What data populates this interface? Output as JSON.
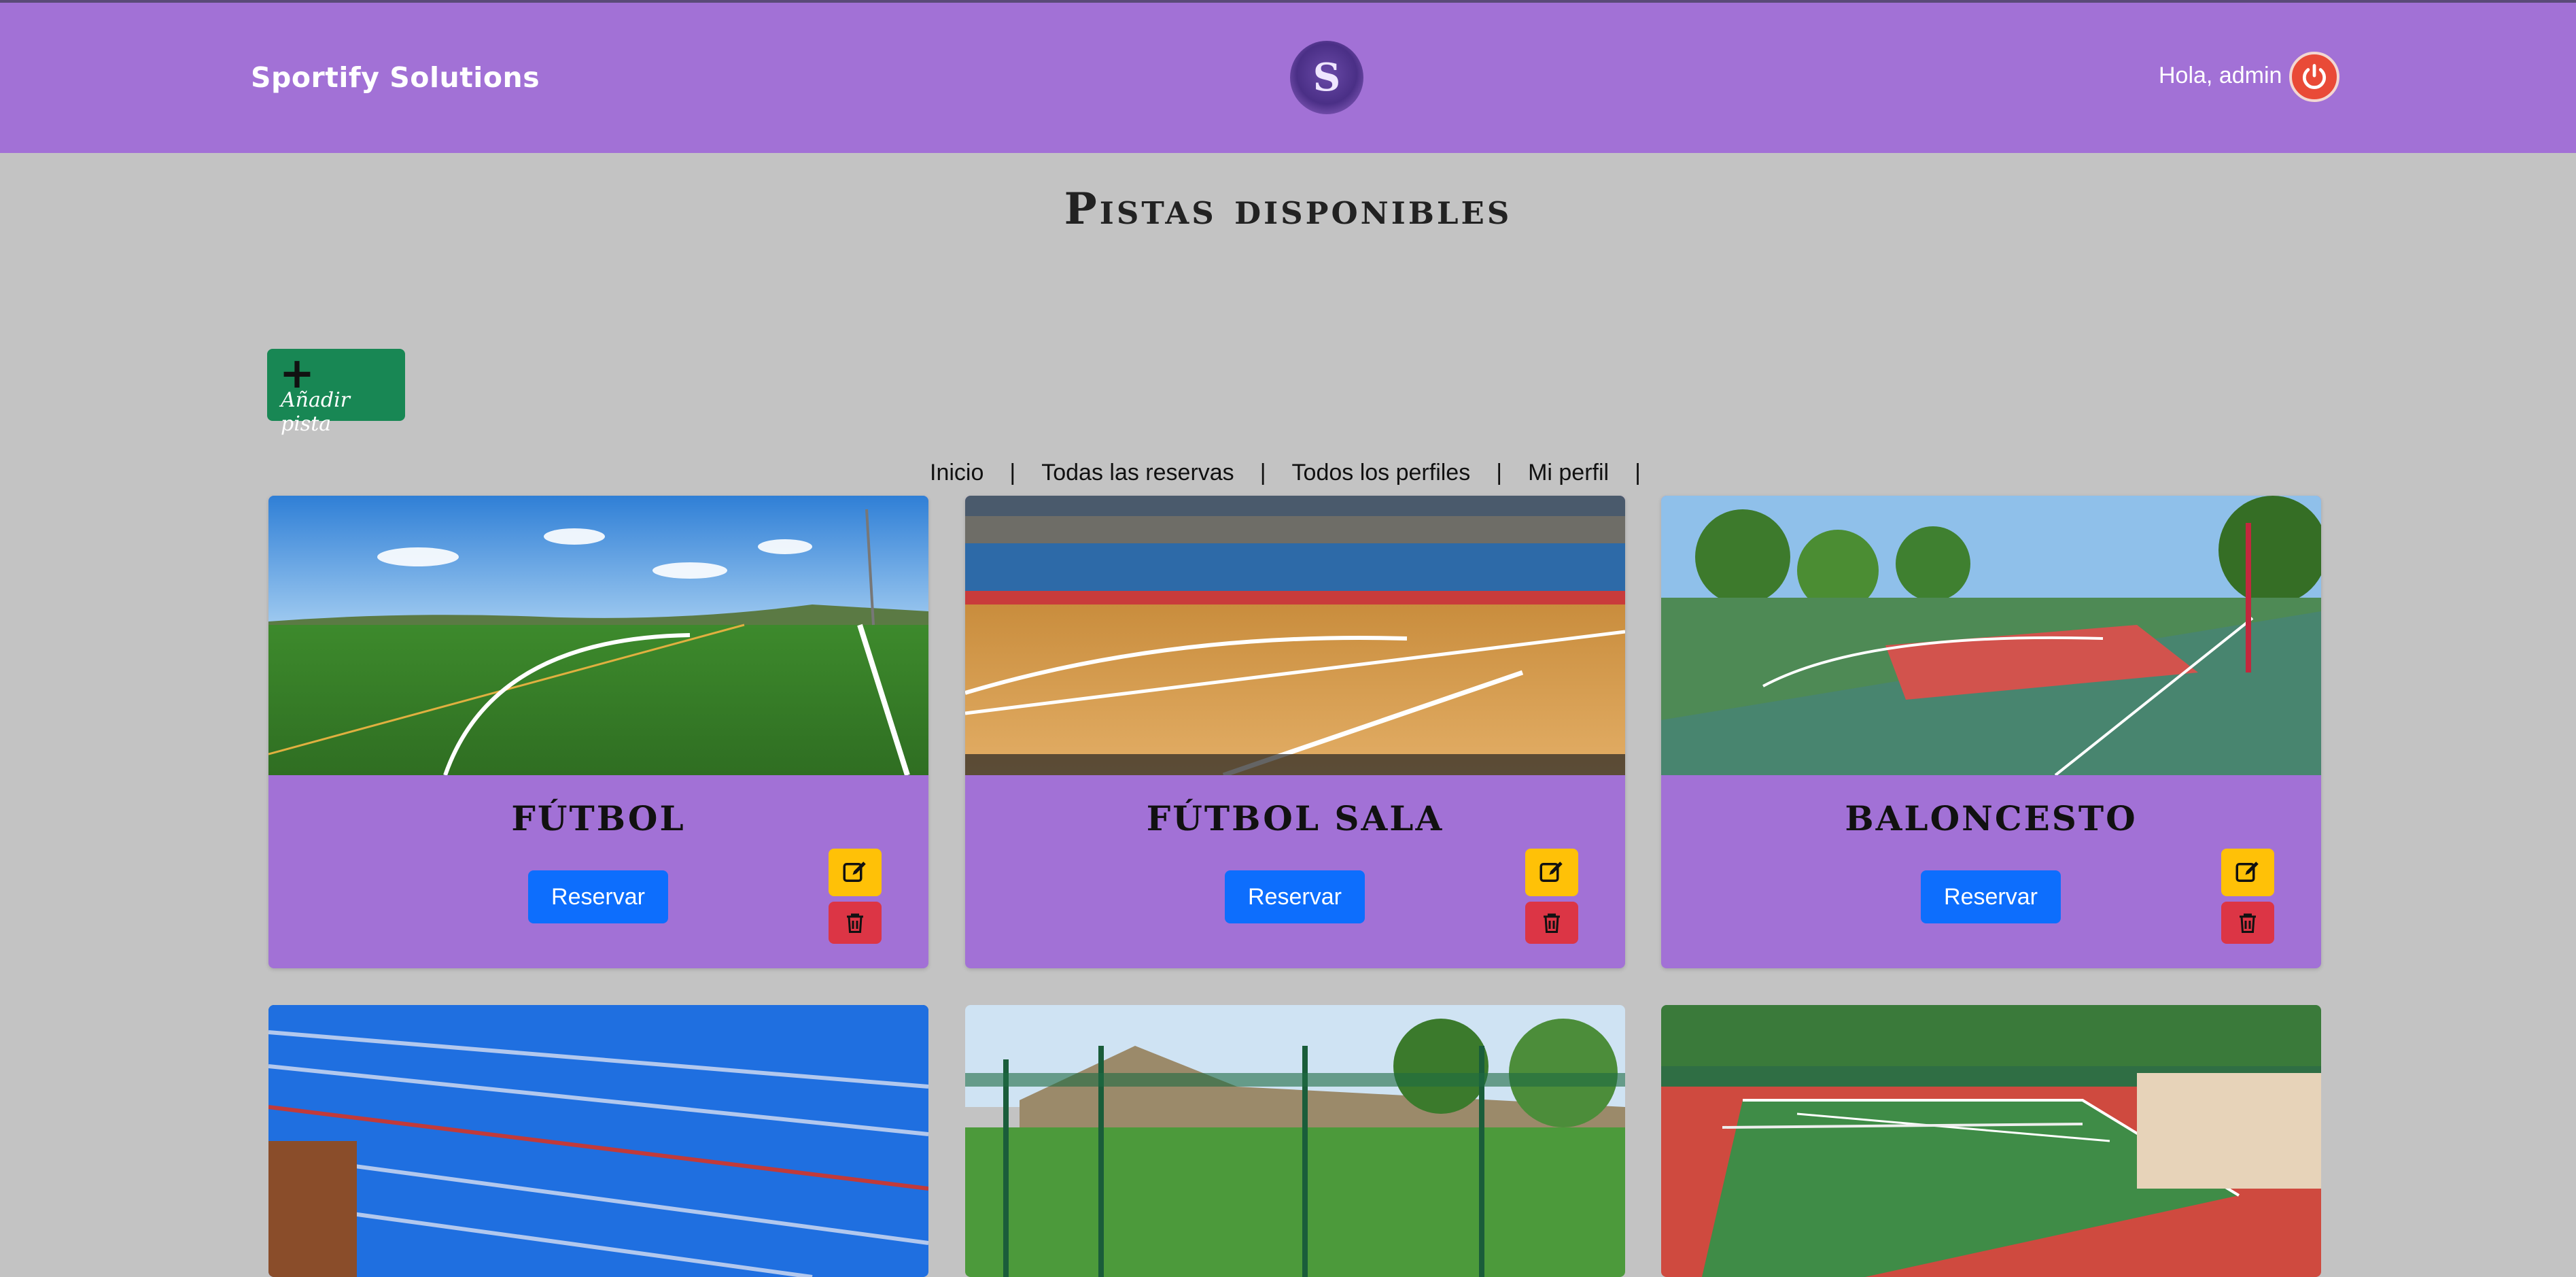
{
  "header": {
    "brand": "Sportify Solutions",
    "logo_letter": "S",
    "greeting": "Hola, admin"
  },
  "page": {
    "title": "Pistas disponibles",
    "add_button_label": "Añadir pista"
  },
  "nav": {
    "items": [
      "Inicio",
      "Todas las reservas",
      "Todos los perfiles",
      "Mi perfil"
    ],
    "separator": "|"
  },
  "cards": [
    {
      "title": "FÚTBOL",
      "button": "Reservar",
      "image": "soccer-field"
    },
    {
      "title": "FÚTBOL SALA",
      "button": "Reservar",
      "image": "indoor-court"
    },
    {
      "title": "BALONCESTO",
      "button": "Reservar",
      "image": "basketball-court"
    }
  ],
  "cards_row2": [
    {
      "image": "swimming-pool"
    },
    {
      "image": "padel-court"
    },
    {
      "image": "tennis-court"
    }
  ],
  "colors": {
    "header": "#a271d6",
    "background": "#c3c3c3",
    "add_button": "#188754",
    "reserve_button": "#0d6efd",
    "edit_button": "#ffc107",
    "delete_button": "#dc3545",
    "power_button": "#e94a37"
  },
  "icons": {
    "power": "power-icon",
    "edit": "edit-icon",
    "delete": "trash-icon",
    "add": "plus-icon"
  }
}
